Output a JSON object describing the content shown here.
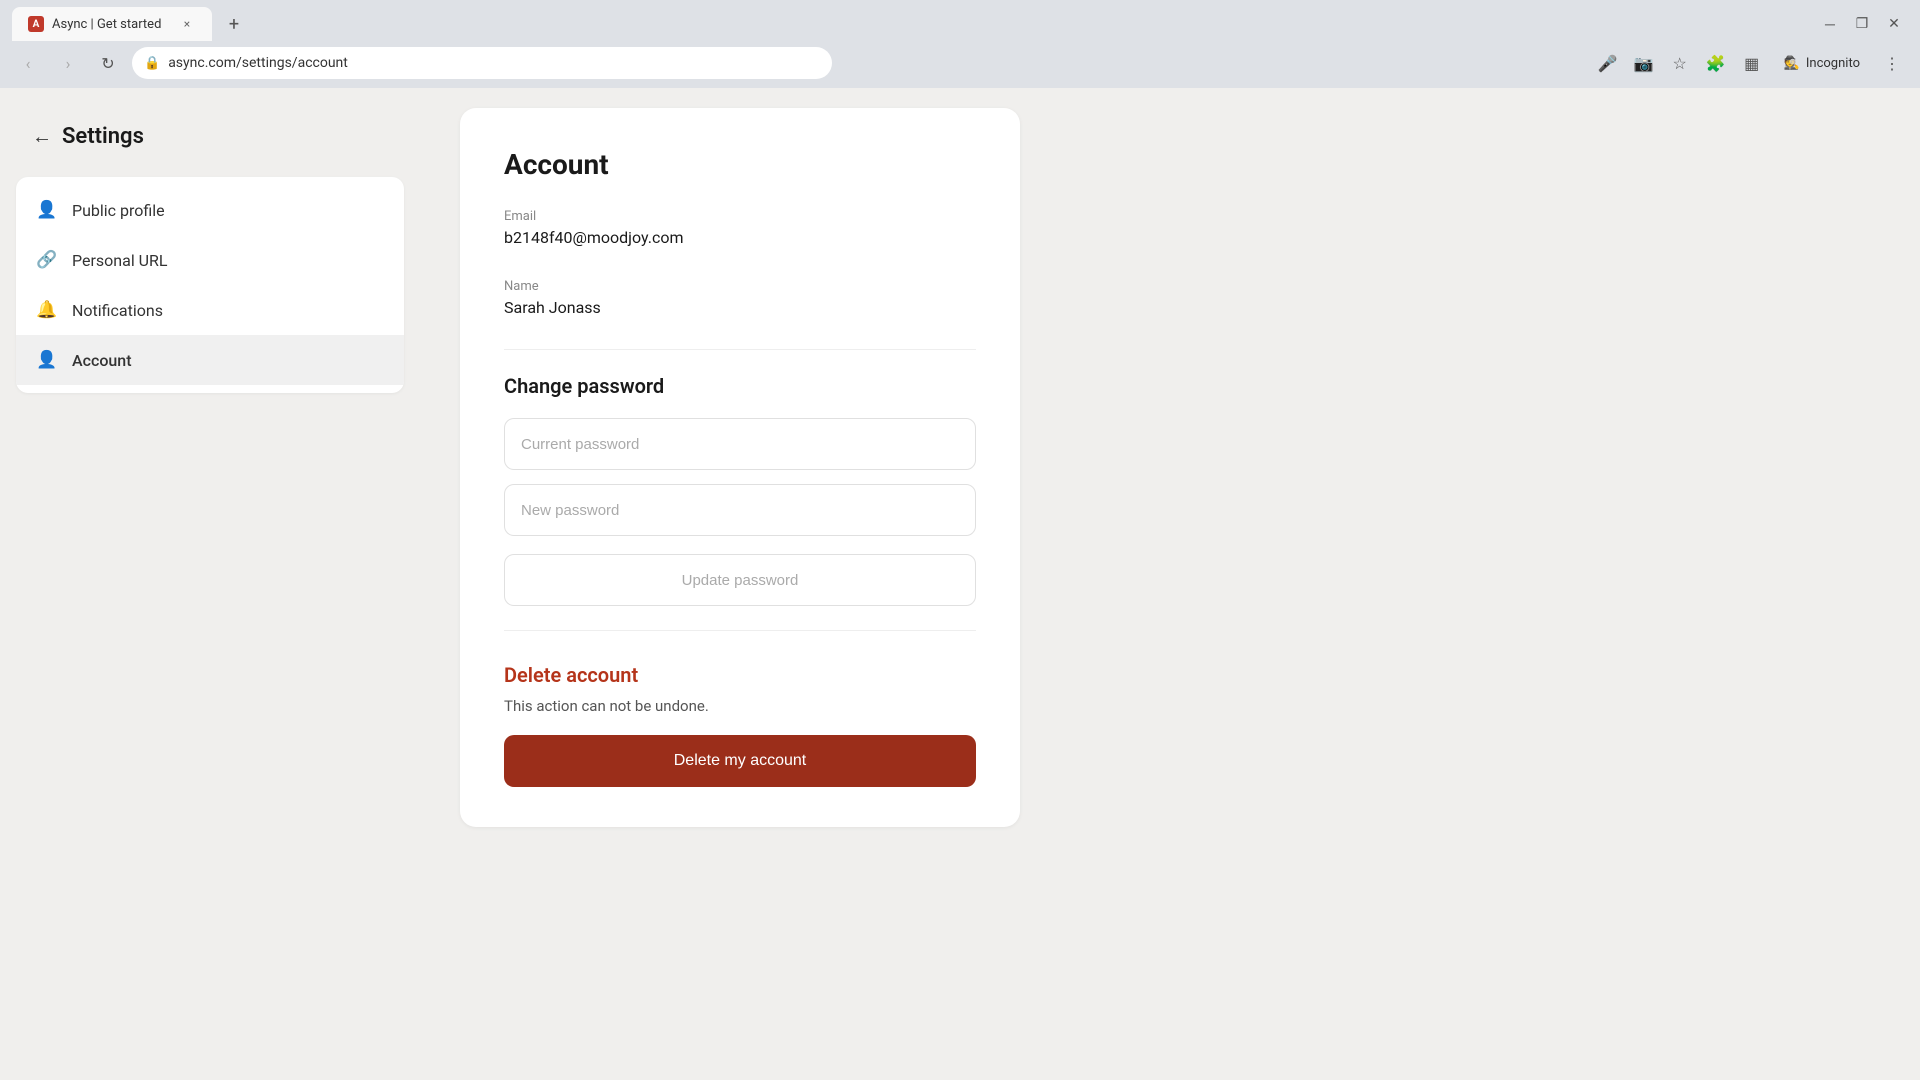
{
  "browser": {
    "tab": {
      "favicon_letter": "A",
      "title": "Async | Get started",
      "close_label": "×"
    },
    "new_tab_label": "+",
    "window_controls": {
      "minimize": "─",
      "restore": "❐",
      "close": "✕"
    },
    "nav": {
      "back_label": "‹",
      "forward_label": "›",
      "reload_label": "↻"
    },
    "address": {
      "lock_icon": "🔒",
      "url": "async.com/settings/account"
    },
    "toolbar_icons": {
      "mic": "🎤",
      "camera_off": "📷",
      "star": "☆",
      "extensions": "🧩",
      "sidebar": "▦",
      "incognito": "🕵",
      "incognito_label": "Incognito",
      "menu": "⋮"
    }
  },
  "sidebar": {
    "back_icon": "←",
    "title": "Settings",
    "nav_items": [
      {
        "id": "public-profile",
        "icon": "👤",
        "label": "Public profile"
      },
      {
        "id": "personal-url",
        "icon": "🔗",
        "label": "Personal URL"
      },
      {
        "id": "notifications",
        "icon": "🔔",
        "label": "Notifications"
      },
      {
        "id": "account",
        "icon": "👤",
        "label": "Account",
        "active": true
      }
    ]
  },
  "main": {
    "page_title": "Account",
    "email_label": "Email",
    "email_value": "b2148f40@moodjoy.com",
    "name_label": "Name",
    "name_value": "Sarah Jonass",
    "change_password_title": "Change password",
    "current_password_placeholder": "Current password",
    "new_password_placeholder": "New password",
    "update_password_label": "Update password",
    "delete_section": {
      "title": "Delete account",
      "description": "This action can not be undone.",
      "button_label": "Delete my account"
    }
  }
}
